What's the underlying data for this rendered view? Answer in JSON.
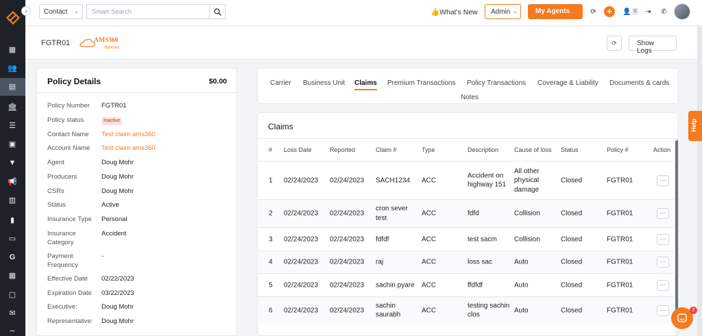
{
  "header": {
    "contact_type": "Contact",
    "search_placeholder": "Smart Search",
    "whats_new": "What's New",
    "admin_label": "Admin",
    "my_agents_label": "My Agents",
    "user_count": "0"
  },
  "subheader": {
    "policy_code": "FGTR01",
    "ams_title": "AMS360",
    "ams_status": "Synced",
    "show_logs": "Show Logs"
  },
  "policy_details": {
    "title": "Policy Details",
    "amount": "$0.00",
    "rows": [
      {
        "label": "Policy Number",
        "value": "FGTR01"
      },
      {
        "label": "Policy status",
        "value": "Inactive"
      },
      {
        "label": "Contact Name",
        "value": "Test claim ams360"
      },
      {
        "label": "Account Name",
        "value": "Test claim ams360"
      },
      {
        "label": "Agent",
        "value": "Doug Mohr"
      },
      {
        "label": "Producers",
        "value": "Doug Mohr"
      },
      {
        "label": "CSRs",
        "value": "Doug Mohr"
      },
      {
        "label": "Status",
        "value": "Active"
      },
      {
        "label": "Insurance Type",
        "value": "Personal"
      },
      {
        "label": "Insurance Category",
        "value": "Accident"
      },
      {
        "label": "Payment Frequency",
        "value": "-"
      },
      {
        "label": "Effective Date",
        "value": "02/22/2023"
      },
      {
        "label": "Expiration Date",
        "value": "03/22/2023"
      },
      {
        "label": "Executive:",
        "value": "Doug Mohr"
      },
      {
        "label": "Representative:",
        "value": "Doug Mohr"
      }
    ]
  },
  "tabs": [
    "Carrier",
    "Business Unit",
    "Claims",
    "Premium Transactions",
    "Policy Transactions",
    "Coverage & Liability",
    "Documents & cards",
    "Notes"
  ],
  "claims": {
    "title": "Claims",
    "columns": [
      "#",
      "Loss Date",
      "Reported",
      "Claim #",
      "Type",
      "Description",
      "Cause of loss",
      "Status",
      "Policy #",
      "Action"
    ],
    "rows": [
      {
        "n": "1",
        "loss": "02/24/2023",
        "reported": "02/24/2023",
        "claim": "SACH1234",
        "type": "ACC",
        "desc": "Accident on highway 151",
        "cause": "All other physical damage",
        "status": "Closed",
        "policy": "FGTR01"
      },
      {
        "n": "2",
        "loss": "02/24/2023",
        "reported": "02/24/2023",
        "claim": "cron sever test",
        "type": "ACC",
        "desc": "fdfd",
        "cause": "Collision",
        "status": "Closed",
        "policy": "FGTR01"
      },
      {
        "n": "3",
        "loss": "02/24/2023",
        "reported": "02/24/2023",
        "claim": "fdfdf",
        "type": "ACC",
        "desc": "test sacm",
        "cause": "Collision",
        "status": "Closed",
        "policy": "FGTR01"
      },
      {
        "n": "4",
        "loss": "02/24/2023",
        "reported": "02/24/2023",
        "claim": "raj",
        "type": "ACC",
        "desc": "loss sac",
        "cause": "Auto",
        "status": "Closed",
        "policy": "FGTR01"
      },
      {
        "n": "5",
        "loss": "02/24/2023",
        "reported": "02/24/2023",
        "claim": "sachin pyare",
        "type": "ACC",
        "desc": "ffdfdf",
        "cause": "Auto",
        "status": "Closed",
        "policy": "FGTR01"
      },
      {
        "n": "6",
        "loss": "02/24/2023",
        "reported": "02/24/2023",
        "claim": "sachin saurabh",
        "type": "ACC",
        "desc": "testing sachin clos",
        "cause": "Auto",
        "status": "Closed",
        "policy": "FGTR01"
      }
    ],
    "action_label": "···"
  },
  "help_label": "Help",
  "chat_badge": "2",
  "colors": {
    "accent": "#f47b20",
    "rail": "#1e2228",
    "inactive": "#dc2626"
  }
}
